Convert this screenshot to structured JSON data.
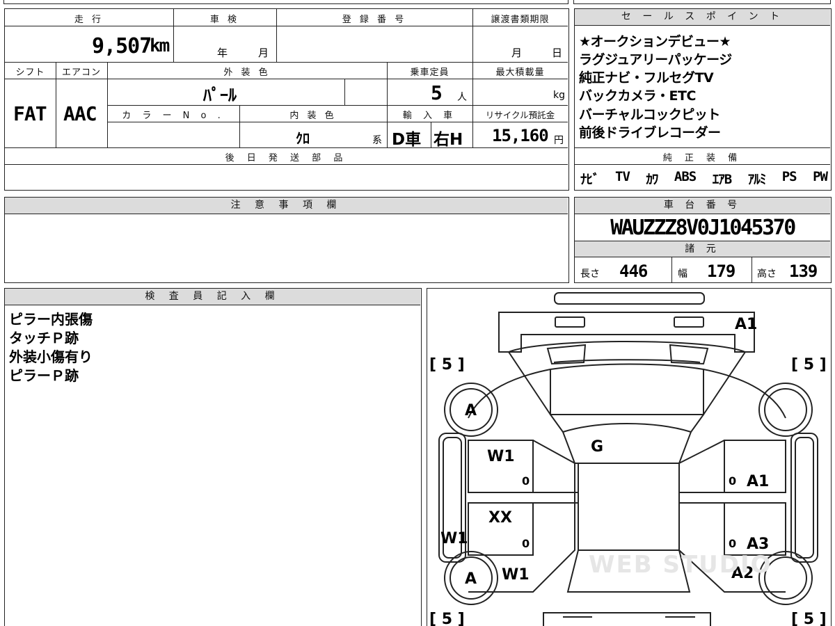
{
  "vehicle": {
    "headers": {
      "mileage": "走 行",
      "inspection": "車 検",
      "registration": "登 録 番 号",
      "transfer_deadline": "譲渡書類期限",
      "shift": "シフト",
      "aircon": "エアコン",
      "exterior_color": "外 装 色",
      "capacity": "乗車定員",
      "max_load": "最大積載量",
      "color_no": "カ ラ ー N o .",
      "interior_color": "内 装 色",
      "import": "輸 入 車",
      "recycle_fee": "リサイクル預託金",
      "later_parts": "後 日 発 送 部 品"
    },
    "mileage_value": "9,507",
    "mileage_unit": "km",
    "inspection_year": "年",
    "inspection_month": "月",
    "transfer_month": "月",
    "transfer_day": "日",
    "shift_value": "FAT",
    "aircon_value": "AAC",
    "exterior_value": "ﾊﾟｰﾙ",
    "capacity_value": "5",
    "capacity_unit": "人",
    "max_load_unit": "kg",
    "interior_value": "ｸﾛ",
    "interior_suffix": "系",
    "import_d": "D車",
    "import_h": "右H",
    "recycle_value": "15,160",
    "recycle_unit": "円"
  },
  "sales_points": {
    "header": "セ ー ル ス ポ イ ン ト",
    "lines": [
      "★オークションデビュー★",
      "ラグジュアリーパッケージ",
      "純正ナビ・フルセグTV",
      "バックカメラ・ETC",
      "バーチャルコックピット",
      "前後ドライブレコーダー"
    ]
  },
  "equipment": {
    "header": "純 正 装 備",
    "items": [
      "ﾅﾋﾞ",
      "TV",
      "ｶﾜ",
      "ABS",
      "ｴｱB",
      "ｱﾙﾐ",
      "PS",
      "PW"
    ]
  },
  "notes": {
    "header": "注 意 事 項 欄"
  },
  "chassis": {
    "header": "車 台 番 号",
    "number": "WAUZZZ8V0J1045370",
    "specs_header": "諸 元",
    "length_label": "長さ",
    "length_value": "446",
    "width_label": "幅",
    "width_value": "179",
    "height_label": "高さ",
    "height_value": "139"
  },
  "inspector": {
    "header": "検 査 員 記 入 欄",
    "lines": [
      "ピラー内張傷",
      "タッチＰ跡",
      "外装小傷有り",
      "ピラーＰ跡"
    ]
  },
  "diagram": {
    "tire_marks": [
      "[ 5 ]",
      "[ 5 ]",
      "[ 5 ]",
      "[ 5 ]"
    ],
    "marks": {
      "front_bumper": "A1",
      "front_left_fender": "A",
      "windshield": "G",
      "left_front_door": "W1",
      "left_rear_door": "XX",
      "left_pillar": "W1",
      "rear_left_fender": "A",
      "left_rear_quarter": "W1",
      "right_front_door": "A1",
      "right_rear_door": "A3",
      "right_rear_quarter": "A2",
      "handle_lf": "0",
      "handle_lr": "0",
      "handle_rf": "0",
      "handle_rr": "0"
    },
    "watermark": "WEB STUDIO"
  }
}
